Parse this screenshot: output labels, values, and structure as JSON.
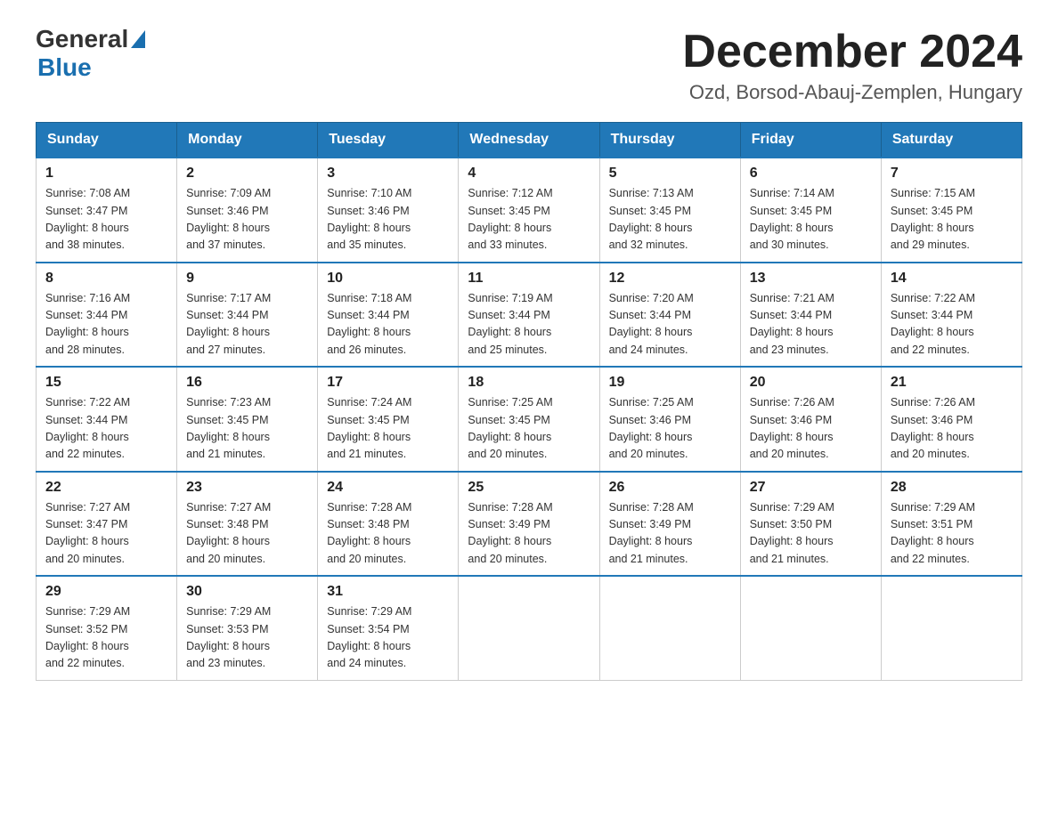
{
  "header": {
    "logo_general": "General",
    "logo_blue": "Blue",
    "month_title": "December 2024",
    "subtitle": "Ozd, Borsod-Abauj-Zemplen, Hungary"
  },
  "weekdays": [
    "Sunday",
    "Monday",
    "Tuesday",
    "Wednesday",
    "Thursday",
    "Friday",
    "Saturday"
  ],
  "weeks": [
    [
      {
        "day": "1",
        "sunrise": "7:08 AM",
        "sunset": "3:47 PM",
        "daylight": "8 hours and 38 minutes."
      },
      {
        "day": "2",
        "sunrise": "7:09 AM",
        "sunset": "3:46 PM",
        "daylight": "8 hours and 37 minutes."
      },
      {
        "day": "3",
        "sunrise": "7:10 AM",
        "sunset": "3:46 PM",
        "daylight": "8 hours and 35 minutes."
      },
      {
        "day": "4",
        "sunrise": "7:12 AM",
        "sunset": "3:45 PM",
        "daylight": "8 hours and 33 minutes."
      },
      {
        "day": "5",
        "sunrise": "7:13 AM",
        "sunset": "3:45 PM",
        "daylight": "8 hours and 32 minutes."
      },
      {
        "day": "6",
        "sunrise": "7:14 AM",
        "sunset": "3:45 PM",
        "daylight": "8 hours and 30 minutes."
      },
      {
        "day": "7",
        "sunrise": "7:15 AM",
        "sunset": "3:45 PM",
        "daylight": "8 hours and 29 minutes."
      }
    ],
    [
      {
        "day": "8",
        "sunrise": "7:16 AM",
        "sunset": "3:44 PM",
        "daylight": "8 hours and 28 minutes."
      },
      {
        "day": "9",
        "sunrise": "7:17 AM",
        "sunset": "3:44 PM",
        "daylight": "8 hours and 27 minutes."
      },
      {
        "day": "10",
        "sunrise": "7:18 AM",
        "sunset": "3:44 PM",
        "daylight": "8 hours and 26 minutes."
      },
      {
        "day": "11",
        "sunrise": "7:19 AM",
        "sunset": "3:44 PM",
        "daylight": "8 hours and 25 minutes."
      },
      {
        "day": "12",
        "sunrise": "7:20 AM",
        "sunset": "3:44 PM",
        "daylight": "8 hours and 24 minutes."
      },
      {
        "day": "13",
        "sunrise": "7:21 AM",
        "sunset": "3:44 PM",
        "daylight": "8 hours and 23 minutes."
      },
      {
        "day": "14",
        "sunrise": "7:22 AM",
        "sunset": "3:44 PM",
        "daylight": "8 hours and 22 minutes."
      }
    ],
    [
      {
        "day": "15",
        "sunrise": "7:22 AM",
        "sunset": "3:44 PM",
        "daylight": "8 hours and 22 minutes."
      },
      {
        "day": "16",
        "sunrise": "7:23 AM",
        "sunset": "3:45 PM",
        "daylight": "8 hours and 21 minutes."
      },
      {
        "day": "17",
        "sunrise": "7:24 AM",
        "sunset": "3:45 PM",
        "daylight": "8 hours and 21 minutes."
      },
      {
        "day": "18",
        "sunrise": "7:25 AM",
        "sunset": "3:45 PM",
        "daylight": "8 hours and 20 minutes."
      },
      {
        "day": "19",
        "sunrise": "7:25 AM",
        "sunset": "3:46 PM",
        "daylight": "8 hours and 20 minutes."
      },
      {
        "day": "20",
        "sunrise": "7:26 AM",
        "sunset": "3:46 PM",
        "daylight": "8 hours and 20 minutes."
      },
      {
        "day": "21",
        "sunrise": "7:26 AM",
        "sunset": "3:46 PM",
        "daylight": "8 hours and 20 minutes."
      }
    ],
    [
      {
        "day": "22",
        "sunrise": "7:27 AM",
        "sunset": "3:47 PM",
        "daylight": "8 hours and 20 minutes."
      },
      {
        "day": "23",
        "sunrise": "7:27 AM",
        "sunset": "3:48 PM",
        "daylight": "8 hours and 20 minutes."
      },
      {
        "day": "24",
        "sunrise": "7:28 AM",
        "sunset": "3:48 PM",
        "daylight": "8 hours and 20 minutes."
      },
      {
        "day": "25",
        "sunrise": "7:28 AM",
        "sunset": "3:49 PM",
        "daylight": "8 hours and 20 minutes."
      },
      {
        "day": "26",
        "sunrise": "7:28 AM",
        "sunset": "3:49 PM",
        "daylight": "8 hours and 21 minutes."
      },
      {
        "day": "27",
        "sunrise": "7:29 AM",
        "sunset": "3:50 PM",
        "daylight": "8 hours and 21 minutes."
      },
      {
        "day": "28",
        "sunrise": "7:29 AM",
        "sunset": "3:51 PM",
        "daylight": "8 hours and 22 minutes."
      }
    ],
    [
      {
        "day": "29",
        "sunrise": "7:29 AM",
        "sunset": "3:52 PM",
        "daylight": "8 hours and 22 minutes."
      },
      {
        "day": "30",
        "sunrise": "7:29 AM",
        "sunset": "3:53 PM",
        "daylight": "8 hours and 23 minutes."
      },
      {
        "day": "31",
        "sunrise": "7:29 AM",
        "sunset": "3:54 PM",
        "daylight": "8 hours and 24 minutes."
      },
      null,
      null,
      null,
      null
    ]
  ],
  "labels": {
    "sunrise": "Sunrise: ",
    "sunset": "Sunset: ",
    "daylight": "Daylight: "
  }
}
